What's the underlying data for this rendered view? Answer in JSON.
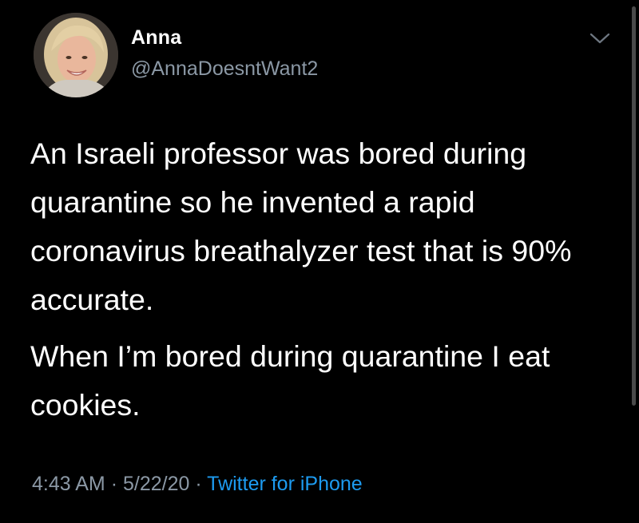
{
  "author": {
    "display_name": "Anna",
    "handle": "@AnnaDoesntWant2"
  },
  "tweet": {
    "paragraphs": [
      "An Israeli professor was bored during quarantine so he invented a rapid coronavirus breathalyzer test that is 90% accurate.",
      "When I’m bored during quarantine I eat cookies."
    ],
    "time": "4:43 AM",
    "separator": "·",
    "date": "5/22/20",
    "source": "Twitter for iPhone"
  },
  "colors": {
    "background": "#000000",
    "text": "#ffffff",
    "secondary_text": "#8b98a5",
    "link": "#1d9bf0"
  },
  "icons": {
    "more": "chevron-down-icon",
    "avatar": "profile-photo"
  }
}
